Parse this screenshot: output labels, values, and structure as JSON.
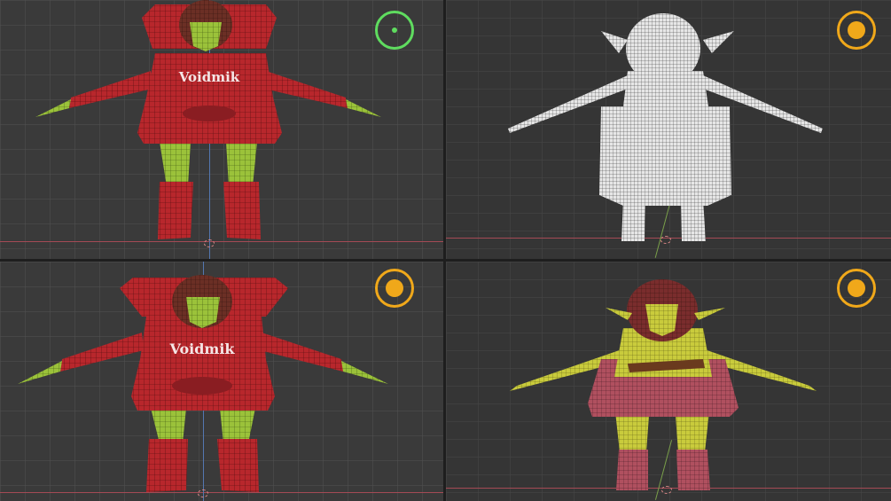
{
  "viewports": [
    {
      "id": "top-left",
      "shading": "solid-wireframe",
      "gizmo": "green",
      "hoodie_text": "Voidmik"
    },
    {
      "id": "top-right",
      "shading": "wireframe-white",
      "gizmo": "orange"
    },
    {
      "id": "bottom-left",
      "shading": "solid-wireframe",
      "gizmo": "orange",
      "hoodie_text": "Voidmik"
    },
    {
      "id": "bottom-right",
      "shading": "solid-wireframe-outfit",
      "gizmo": "orange"
    }
  ],
  "colors": {
    "grid_bg": "#3a3a3a",
    "hoodie_red": "#b8272c",
    "skin_green": "#9bc23a",
    "hair_brown": "#6b2f25",
    "gizmo_green": "#5fdc5f",
    "gizmo_orange": "#f0a81a"
  },
  "icons": [
    "view-gizmo-icon"
  ]
}
